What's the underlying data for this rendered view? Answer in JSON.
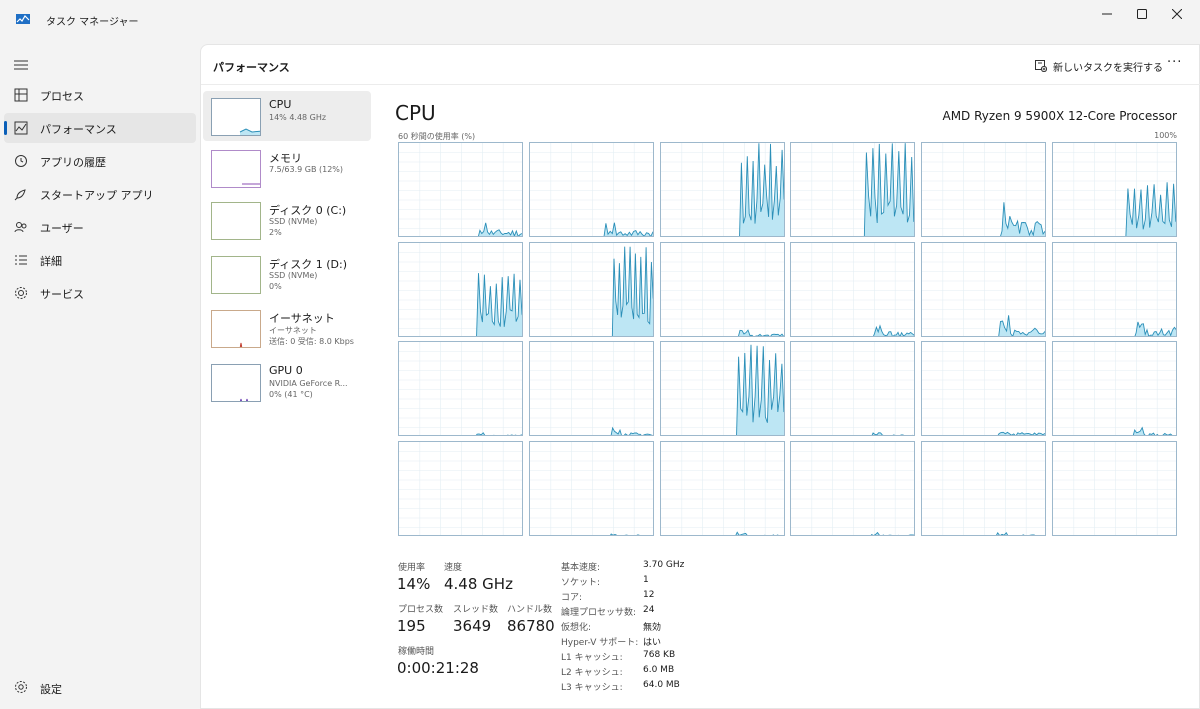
{
  "window": {
    "title": "タスク マネージャー",
    "minimize_glyph": "—",
    "maximize_glyph": "☐",
    "close_glyph": "✕"
  },
  "nav": {
    "items": [
      {
        "label": "プロセス",
        "icon": "processes-icon"
      },
      {
        "label": "パフォーマンス",
        "icon": "performance-icon",
        "active": true
      },
      {
        "label": "アプリの履歴",
        "icon": "history-icon"
      },
      {
        "label": "スタートアップ アプリ",
        "icon": "startup-icon"
      },
      {
        "label": "ユーザー",
        "icon": "users-icon"
      },
      {
        "label": "詳細",
        "icon": "details-icon"
      },
      {
        "label": "サービス",
        "icon": "services-icon"
      }
    ],
    "settings_label": "設定"
  },
  "header": {
    "title": "パフォーマンス",
    "new_task_label": "新しいタスクを実行する",
    "more_label": "···"
  },
  "devices": [
    {
      "name": "CPU",
      "lines": [
        "14%  4.48 GHz"
      ]
    },
    {
      "name": "メモリ",
      "lines": [
        "7.5/63.9 GB (12%)"
      ]
    },
    {
      "name": "ディスク 0 (C:)",
      "lines": [
        "SSD (NVMe)",
        "2%"
      ]
    },
    {
      "name": "ディスク 1 (D:)",
      "lines": [
        "SSD (NVMe)",
        "0%"
      ]
    },
    {
      "name": "イーサネット",
      "lines": [
        "イーサネット",
        "送信: 0 受信: 8.0 Kbps"
      ]
    },
    {
      "name": "GPU 0",
      "lines": [
        "NVIDIA GeForce R...",
        "0% (41 °C)"
      ]
    }
  ],
  "cpu": {
    "title": "CPU",
    "model": "AMD Ryzen 9 5900X 12-Core Processor",
    "util_label": "60 秒間の使用率 (%)",
    "util_max": "100%",
    "graph_color": "#2b8fb8",
    "graph_fill": "#bde6f4",
    "core_peak_percent": [
      20,
      20,
      100,
      100,
      40,
      60,
      70,
      100,
      10,
      15,
      25,
      25,
      5,
      10,
      100,
      5,
      10,
      10,
      0,
      5,
      5,
      5,
      5,
      0
    ]
  },
  "stats": {
    "usage_label": "使用率",
    "usage_value": "14%",
    "speed_label": "速度",
    "speed_value": "4.48 GHz",
    "processes_label": "プロセス数",
    "processes_value": "195",
    "threads_label": "スレッド数",
    "threads_value": "3649",
    "handles_label": "ハンドル数",
    "handles_value": "86780",
    "uptime_label": "稼働時間",
    "uptime_value": "0:00:21:28"
  },
  "specs": [
    {
      "k": "基本速度:",
      "v": "3.70 GHz"
    },
    {
      "k": "ソケット:",
      "v": "1"
    },
    {
      "k": "コア:",
      "v": "12"
    },
    {
      "k": "論理プロセッサ数:",
      "v": "24"
    },
    {
      "k": "仮想化:",
      "v": "無効"
    },
    {
      "k": "Hyper-V サポート:",
      "v": "はい"
    },
    {
      "k": "L1 キャッシュ:",
      "v": "768 KB"
    },
    {
      "k": "L2 キャッシュ:",
      "v": "6.0 MB"
    },
    {
      "k": "L3 キャッシュ:",
      "v": "64.0 MB"
    }
  ]
}
